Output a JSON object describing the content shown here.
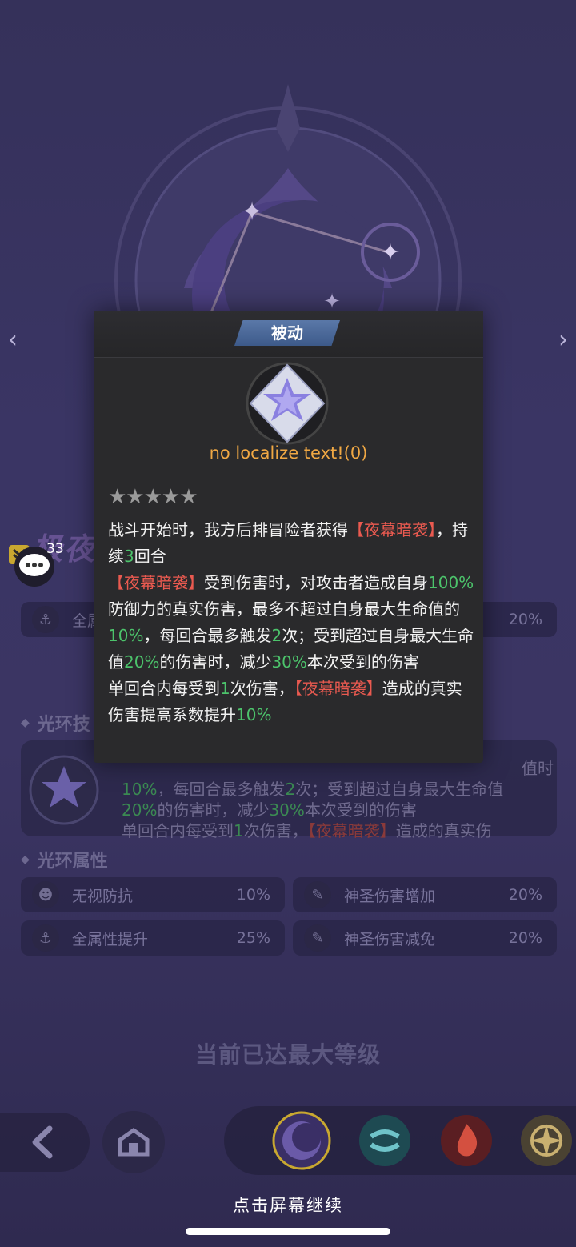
{
  "popup": {
    "tab_label": "被动",
    "subtitle": "no localize text!(0)",
    "stars": "★★★★★",
    "desc_line1_a": "战斗开始时，我方后排冒险者获得",
    "desc_line1_b": "【夜幕暗袭】",
    "desc_line1_c": "，持续",
    "desc_line1_d": "3",
    "desc_line1_e": "回合",
    "desc_line2_a": "【夜幕暗袭】",
    "desc_line2_b": "受到伤害时，对攻击者造成自身",
    "desc_line2_c": "100%",
    "desc_line2_d": "防御力的真实伤害，最多不超过自身最大生命值的",
    "desc_line2_e": "10%",
    "desc_line2_f": "，每回合最多触发",
    "desc_line2_g": "2",
    "desc_line2_h": "次；受到超过自身最大生命值",
    "desc_line2_i": "20%",
    "desc_line2_j": "的伤害时，减少",
    "desc_line2_k": "30%",
    "desc_line2_l": "本次受到的伤害",
    "desc_line3_a": "单回合内每受到",
    "desc_line3_b": "1",
    "desc_line3_c": "次伤害，",
    "desc_line3_d": "【夜幕暗袭】",
    "desc_line3_e": "造成的真实伤害提高系数提升",
    "desc_line3_f": "10%"
  },
  "hero": {
    "name_partial": "极夜"
  },
  "chat": {
    "count": "33"
  },
  "top_attr": {
    "label_partial": "全属",
    "value": "20%"
  },
  "aura_skill": {
    "title": "光环技",
    "line0": "值时",
    "line1_a": "10%",
    "line1_b": "，每回合最多触发",
    "line1_c": "2",
    "line1_d": "次；受到超过自身最大生命值",
    "line2_a": "20%",
    "line2_b": "的伤害时，减少",
    "line2_c": "30%",
    "line2_d": "本次受到的伤害",
    "line3_a": "单回合内每受到",
    "line3_b": "1",
    "line3_c": "次伤害，",
    "line3_d": "【夜幕暗袭】",
    "line3_e": "造成的真实伤"
  },
  "aura_attributes": {
    "title": "光环属性",
    "items": [
      {
        "label": "无视防抗",
        "value": "10%",
        "icon": "helmet-icon"
      },
      {
        "label": "神圣伤害增加",
        "value": "20%",
        "icon": "quill-icon"
      },
      {
        "label": "全属性提升",
        "value": "25%",
        "icon": "anchor-icon"
      },
      {
        "label": "神圣伤害减免",
        "value": "20%",
        "icon": "quill-icon"
      }
    ]
  },
  "max_level_text": "当前已达最大等级",
  "continue_text": "点击屏幕继续",
  "colors": {
    "accent_red": "#ea5a50",
    "accent_green": "#4cc36b",
    "subtitle_orange": "#f0a844"
  }
}
